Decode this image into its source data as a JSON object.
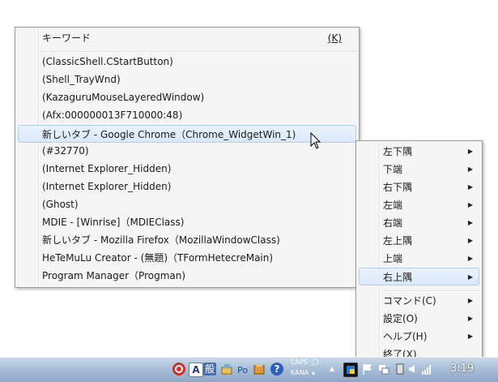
{
  "menu_main": {
    "header": {
      "label": "キーワード",
      "accel": "(K)"
    },
    "items": [
      "(ClassicShell.CStartButton)",
      "(Shell_TrayWnd)",
      "(KazaguruMouseLayeredWindow)",
      "(Afx:000000013F710000:48)",
      "新しいタブ - Google Chrome（Chrome_WidgetWin_1)",
      "(#32770)",
      "(Internet Explorer_Hidden)",
      "(Internet Explorer_Hidden)",
      "(Ghost)",
      "MDIE - [Winrise]（MDIEClass)",
      "新しいタブ - Mozilla Firefox（MozillaWindowClass)",
      "HeTeMuLu Creator - (無題)（TFormHetecreMain)",
      "Program Manager（Progman)"
    ]
  },
  "menu_sub": {
    "positions": [
      "左下隅",
      "下端",
      "右下隅",
      "左端",
      "右端",
      "左上隅",
      "上端",
      "右上隅"
    ],
    "commands": [
      "コマンド(C)",
      "設定(O)",
      "ヘルプ(H)",
      "終了(X)"
    ],
    "arrow": "▶"
  },
  "taskbar": {
    "caps": "CAPS",
    "kana": "KANA",
    "ime_a": "A",
    "ime_mode": "般",
    "clock": "3:19"
  }
}
